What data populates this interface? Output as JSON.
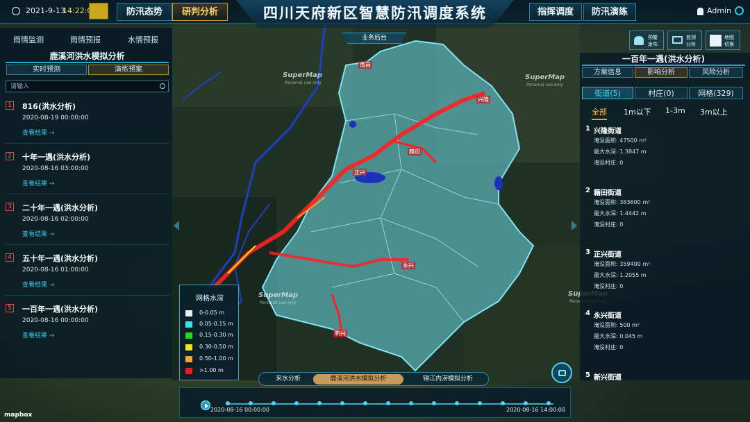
{
  "topbar": {
    "date": "2021-9-13",
    "time": "14:22:02",
    "nav_left": [
      "防汛态势",
      "研判分析"
    ],
    "nav_right": [
      "指挥调度",
      "防汛演练"
    ],
    "title": "四川天府新区智慧防汛调度系统",
    "user": "Admin"
  },
  "left_panel": {
    "tabs": [
      "雨情监测",
      "雨情预报",
      "水情预报"
    ],
    "section_title": "鹿溪河洪水模拟分析",
    "subtabs": [
      "实时预测",
      "演练预案"
    ],
    "search_placeholder": "请输入",
    "scenarios": [
      {
        "num": "1",
        "name": "816(洪水分析)",
        "time": "2020-08-19 00:00:00",
        "link": "查看结果 →"
      },
      {
        "num": "2",
        "name": "十年一遇(洪水分析)",
        "time": "2020-08-16 03:00:00",
        "link": "查看结果 →"
      },
      {
        "num": "3",
        "name": "二十年一遇(洪水分析)",
        "time": "2020-08-16 02:00:00",
        "link": "查看结果 →"
      },
      {
        "num": "4",
        "name": "五十年一遇(洪水分析)",
        "time": "2020-08-16 01:00:00",
        "link": "查看结果 →"
      },
      {
        "num": "5",
        "name": "一百年一遇(洪水分析)",
        "time": "2020-08-16 00:00:00",
        "link": "查看结果 →"
      }
    ]
  },
  "map": {
    "backend_label": "业务后台",
    "watermark": "SuperMap",
    "watermark_sub": "Personal use only",
    "mapbox": "mapbox",
    "place_labels": [
      "南昌",
      "兴隆",
      "正兴",
      "籍田",
      "永兴",
      "新兴"
    ]
  },
  "top_right_buttons": [
    {
      "line1": "预警",
      "line2": "发布"
    },
    {
      "line1": "监测",
      "line2": "分析"
    },
    {
      "line1": "地图",
      "line2": "切换"
    }
  ],
  "legend": {
    "title": "网格水深",
    "items": [
      {
        "label": "0-0.05 m",
        "color": "#e8eef0"
      },
      {
        "label": "0.05-0.15 m",
        "color": "#36e6e6"
      },
      {
        "label": "0.15-0.30 m",
        "color": "#22d622"
      },
      {
        "label": "0.30-0.50 m",
        "color": "#e8e820"
      },
      {
        "label": "0.50-1.00 m",
        "color": "#f5a623"
      },
      {
        "label": ">1.00 m",
        "color": "#ee1c1c"
      }
    ]
  },
  "bottom_tabs": [
    "来水分析",
    "鹿溪河洪水模拟分析",
    "锦江内涝模拟分析"
  ],
  "timeline": {
    "start": "2020-08-16 00:00:00",
    "end": "2020-08-16 14:00:00"
  },
  "right_panel": {
    "section_title": "一百年一遇(洪水分析)",
    "subtabs": [
      "方案信息",
      "影响分析",
      "风险分析"
    ],
    "tabs": [
      "街道(5)",
      "村庄(0)",
      "网格(329)"
    ],
    "filters": [
      "全部",
      "1m以下",
      "1-3m",
      "3m以上"
    ],
    "streets": [
      {
        "num": "1",
        "name": "兴隆街道",
        "area": "淹没面积: 47500 m²",
        "depth": "最大水深: 1.3847 m",
        "villages": "淹没村庄: 0"
      },
      {
        "num": "2",
        "name": "籍田街道",
        "area": "淹没面积: 363600 m²",
        "depth": "最大水深: 1.4442 m",
        "villages": "淹没村庄: 0"
      },
      {
        "num": "3",
        "name": "正兴街道",
        "area": "淹没面积: 359400 m²",
        "depth": "最大水深: 1.2055 m",
        "villages": "淹没村庄: 0"
      },
      {
        "num": "4",
        "name": "永兴街道",
        "area": "淹没面积: 500 m²",
        "depth": "最大水深: 0.045 m",
        "villages": "淹没村庄: 0"
      },
      {
        "num": "5",
        "name": "新兴街道"
      }
    ]
  }
}
